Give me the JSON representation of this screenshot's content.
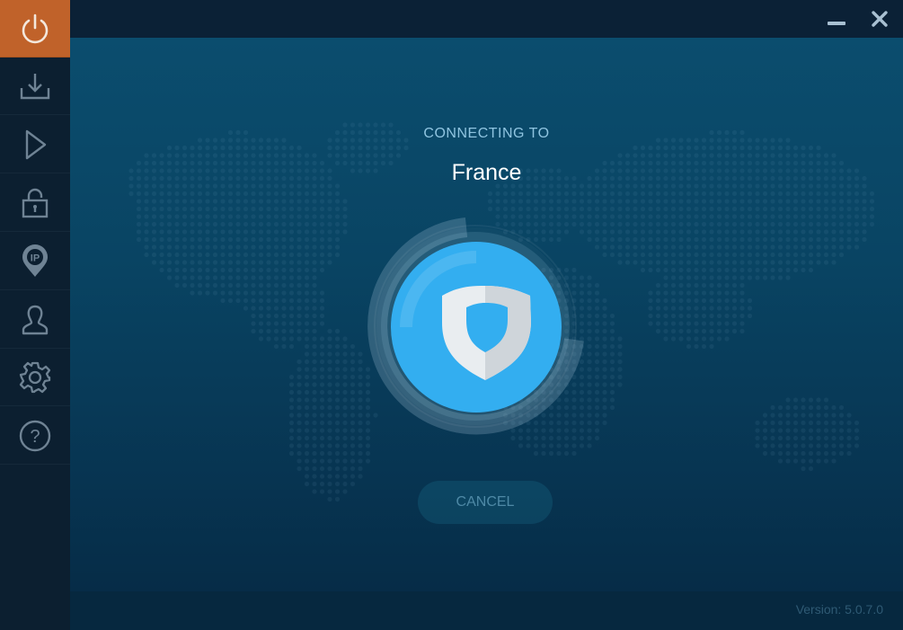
{
  "sidebar": {
    "items": [
      {
        "name": "power",
        "icon": "power-icon",
        "active": true
      },
      {
        "name": "download",
        "icon": "download-icon",
        "active": false
      },
      {
        "name": "play",
        "icon": "play-icon",
        "active": false
      },
      {
        "name": "lock",
        "icon": "lock-icon",
        "active": false
      },
      {
        "name": "ip",
        "icon": "ip-pin-icon",
        "active": false,
        "text": "IP"
      },
      {
        "name": "account",
        "icon": "user-icon",
        "active": false
      },
      {
        "name": "settings",
        "icon": "gear-icon",
        "active": false
      },
      {
        "name": "help",
        "icon": "help-icon",
        "active": false,
        "text": "?"
      }
    ]
  },
  "window": {
    "minimize_icon": "minimize-icon",
    "close_icon": "close-icon"
  },
  "connection": {
    "status_label": "CONNECTING TO",
    "country": "France",
    "cancel_label": "CANCEL"
  },
  "footer": {
    "version": "Version:  5.0.7.0"
  },
  "colors": {
    "accent_active": "#c0622a",
    "shield_button": "#33aef0",
    "sidebar_bg": "#0c1f30",
    "text_label": "#8fc4e0"
  }
}
